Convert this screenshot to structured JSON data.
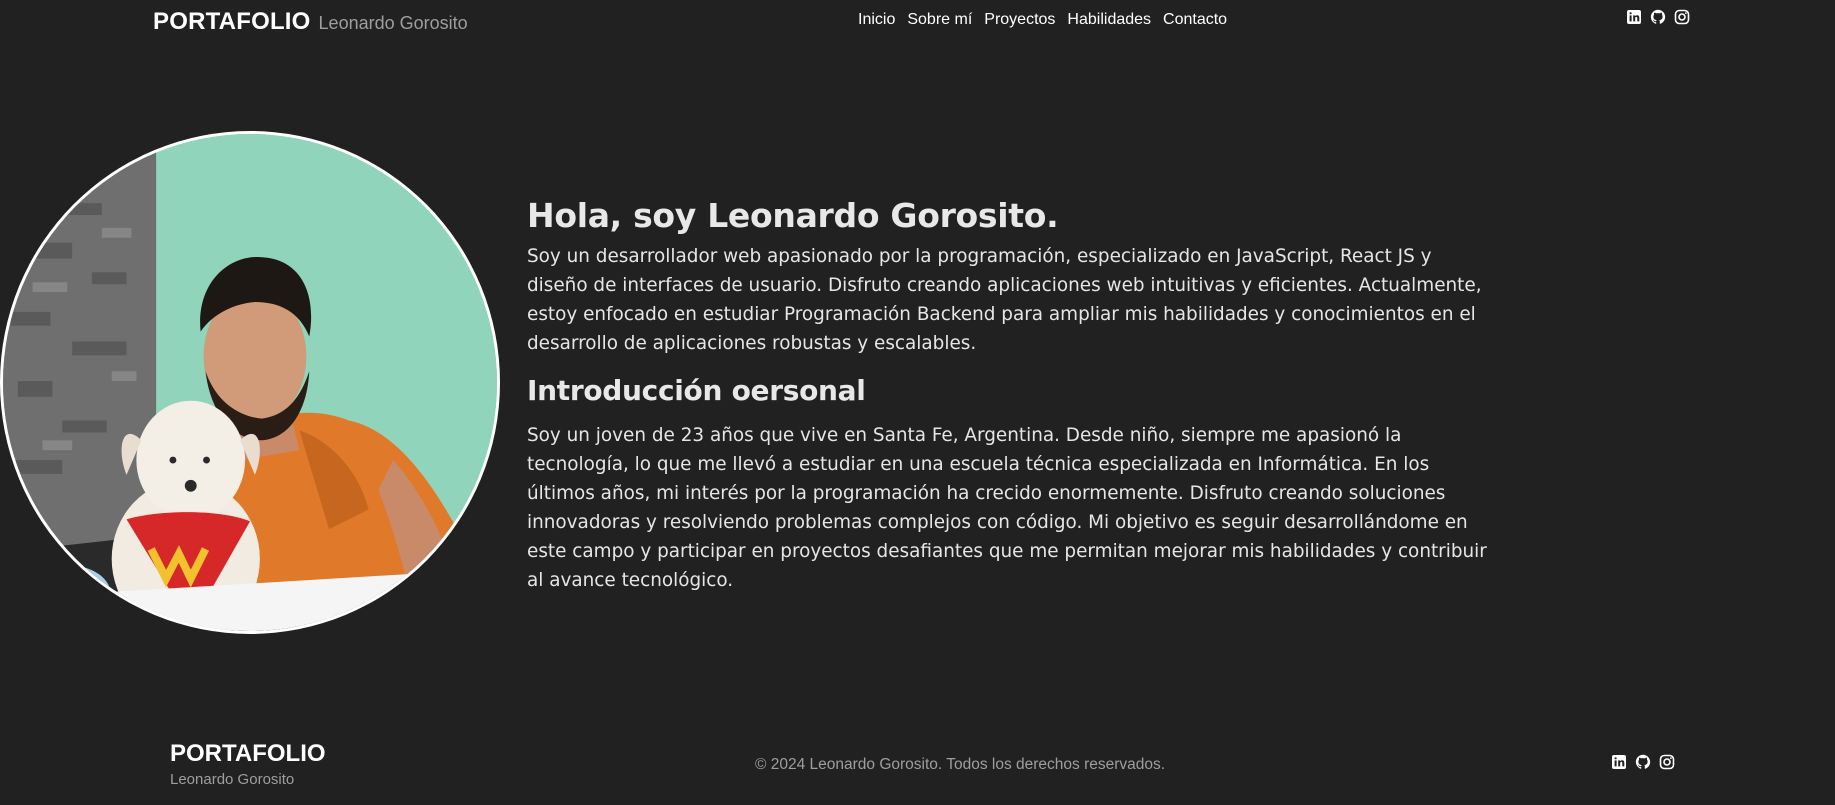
{
  "navbar": {
    "brand_title": "PORTAFOLIO",
    "brand_subtitle": "Leonardo Gorosito",
    "links": [
      {
        "label": "Inicio"
      },
      {
        "label": "Sobre mí"
      },
      {
        "label": "Proyectos"
      },
      {
        "label": "Habilidades"
      },
      {
        "label": "Contacto"
      }
    ]
  },
  "social_icons": [
    "linkedin-icon",
    "github-icon",
    "instagram-icon"
  ],
  "hero": {
    "heading": "Hola, soy Leonardo Gorosito.",
    "intro": "Soy un desarrollador web apasionado por la programación, especializado en JavaScript, React JS y diseño de interfaces de usuario. Disfruto creando aplicaciones web intuitivas y eficientes. Actualmente, estoy enfocado en estudiar Programación Backend para ampliar mis habilidades y conocimientos en el desarrollo de aplicaciones robustas y escalables.",
    "subheading": "Introducción oersonal",
    "personal": "Soy un joven de 23 años que vive en Santa Fe, Argentina. Desde niño, siempre me apasionó la tecnología, lo que me llevó a estudiar en una escuela técnica especializada en Informática. En los últimos años, mi interés por la programación ha crecido enormemente. Disfruto creando soluciones innovadoras y resolviendo problemas complejos con código. Mi objetivo es seguir desarrollándome en este campo y participar en proyectos desafiantes que me permitan mejorar mis habilidades y contribuir al avance tecnológico."
  },
  "footer": {
    "brand_title": "PORTAFOLIO",
    "brand_subtitle": "Leonardo Gorosito",
    "copyright": "© 2024 Leonardo Gorosito. Todos los derechos reservados."
  },
  "colors": {
    "background": "#212121",
    "text": "#ffffff",
    "muted": "#9e9e9e"
  }
}
